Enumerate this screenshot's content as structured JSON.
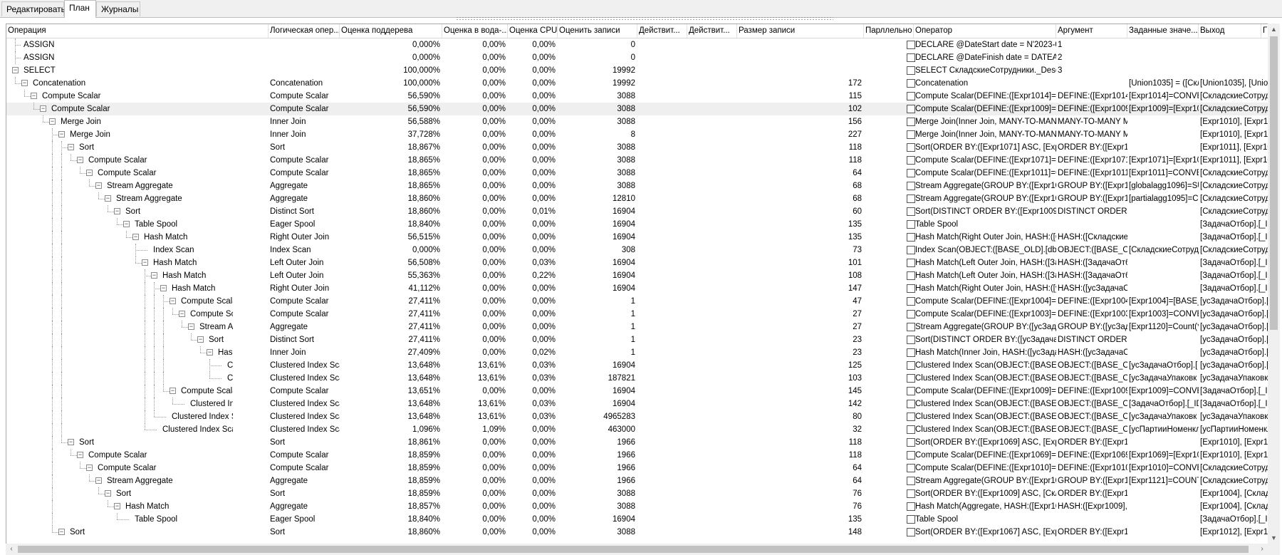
{
  "tabs": [
    {
      "label": "Редактировать",
      "active": false
    },
    {
      "label": "План",
      "active": true
    },
    {
      "label": "Журналы",
      "active": false
    }
  ],
  "columns": [
    "Операция",
    "Логическая опер...",
    "Оценка поддерева",
    "Оценка в вода-...",
    "Оценка CPU",
    "Оценить записи",
    "Действит...",
    "Действит...",
    "Размер записи",
    "Парллельно",
    "Оператор",
    "Аргумент",
    "Заданные значе...",
    "Выход",
    "Г"
  ],
  "rows": [
    {
      "op": "ASSIGN",
      "d": 0,
      "leaf": true,
      "last": false,
      "logical": "",
      "subtree": "0,000%",
      "io": "0,00%",
      "cpu": "0,00%",
      "est": "0",
      "size": "",
      "operator": "DECLARE @DateStart date = N'2023-02-",
      "argument": "1",
      "defined": "",
      "output": ""
    },
    {
      "op": "ASSIGN",
      "d": 0,
      "leaf": true,
      "last": false,
      "logical": "",
      "subtree": "0,000%",
      "io": "0,00%",
      "cpu": "0,00%",
      "est": "0",
      "size": "",
      "operator": "DECLARE @DateFinish date = DATEADD",
      "argument": "2",
      "defined": "",
      "output": ""
    },
    {
      "op": "SELECT",
      "d": 0,
      "leaf": false,
      "last": true,
      "logical": "",
      "subtree": "100,000%",
      "io": "0,00%",
      "cpu": "0,00%",
      "est": "19992",
      "size": "",
      "operator": "SELECT СкладскиеСотрудники._Descri",
      "argument": "3",
      "defined": "",
      "output": ""
    },
    {
      "op": "Concatenation",
      "d": 1,
      "leaf": false,
      "last": true,
      "logical": "Concatenation",
      "subtree": "100,000%",
      "io": "0,00%",
      "cpu": "0,00%",
      "est": "19992",
      "size": "172",
      "operator": "Concatenation",
      "argument": "",
      "defined": "[Union1035] = ([Скла",
      "output": "[Union1035], [Union1"
    },
    {
      "op": "Compute Scalar",
      "d": 2,
      "leaf": false,
      "last": false,
      "logical": "Compute Scalar",
      "subtree": "56,590%",
      "io": "0,00%",
      "cpu": "0,00%",
      "est": "3088",
      "size": "115",
      "operator": "Compute Scalar(DEFINE:([Expr1014]=CO",
      "argument": "DEFINE:([Expr1014]=",
      "defined": "[Expr1014]=CONVER",
      "output": "[СкладскиеСотруд"
    },
    {
      "op": "Compute Scalar",
      "d": 3,
      "leaf": false,
      "last": true,
      "logical": "Compute Scalar",
      "subtree": "56,590%",
      "io": "0,00%",
      "cpu": "0,00%",
      "est": "3088",
      "size": "102",
      "operator": "Compute Scalar(DEFINE:([Expr1009]=[Ex",
      "argument": "DEFINE:([Expr1009]=",
      "defined": "[Expr1009]=[Expr10",
      "output": "[СкладскиеСотруд",
      "sel": true
    },
    {
      "op": "Merge Join",
      "d": 4,
      "leaf": false,
      "last": true,
      "logical": "Inner Join",
      "subtree": "56,588%",
      "io": "0,00%",
      "cpu": "0,00%",
      "est": "3088",
      "size": "156",
      "operator": "Merge Join(Inner Join, MANY-TO-MANY M",
      "argument": "MANY-TO-MANY MI",
      "defined": "",
      "output": "[Expr1010], [Expr10"
    },
    {
      "op": "Merge Join",
      "d": 5,
      "leaf": false,
      "last": false,
      "logical": "Inner Join",
      "subtree": "37,728%",
      "io": "0,00%",
      "cpu": "0,00%",
      "est": "8",
      "size": "227",
      "operator": "Merge Join(Inner Join, MANY-TO-MANY M",
      "argument": "MANY-TO-MANY MI",
      "defined": "",
      "output": "[Expr1010], [Expr10"
    },
    {
      "op": "Sort",
      "d": 6,
      "leaf": false,
      "last": false,
      "logical": "Sort",
      "subtree": "18,867%",
      "io": "0,00%",
      "cpu": "0,00%",
      "est": "3088",
      "size": "118",
      "operator": "Sort(ORDER BY:([Expr1071] ASC, [Expr1",
      "argument": "ORDER BY:([Expr10",
      "defined": "",
      "output": "[Expr1011], [Expr10"
    },
    {
      "op": "Compute Scalar",
      "d": 7,
      "leaf": false,
      "last": true,
      "logical": "Compute Scalar",
      "subtree": "18,865%",
      "io": "0,00%",
      "cpu": "0,00%",
      "est": "3088",
      "size": "118",
      "operator": "Compute Scalar(DEFINE:([Expr1071]=[Ex",
      "argument": "DEFINE:([Expr1071]=",
      "defined": "[Expr1071]=[Expr10",
      "output": "[Expr1011], [Expr10"
    },
    {
      "op": "Compute Scalar",
      "d": 8,
      "leaf": false,
      "last": true,
      "logical": "Compute Scalar",
      "subtree": "18,865%",
      "io": "0,00%",
      "cpu": "0,00%",
      "est": "3088",
      "size": "64",
      "operator": "Compute Scalar(DEFINE:([Expr1011]=CO",
      "argument": "DEFINE:([Expr1011]=",
      "defined": "[Expr1011]=CONVER",
      "output": "[СкладскиеСотруд"
    },
    {
      "op": "Stream Aggregate",
      "d": 9,
      "leaf": false,
      "last": true,
      "logical": "Aggregate",
      "subtree": "18,865%",
      "io": "0,00%",
      "cpu": "0,00%",
      "est": "3088",
      "size": "68",
      "operator": "Stream Aggregate(GROUP BY:([Expr100",
      "argument": "GROUP BY:([Expr10",
      "defined": "[globalagg1096]=SU",
      "output": "[СкладскиеСотруд"
    },
    {
      "op": "Stream Aggregate",
      "d": 10,
      "leaf": false,
      "last": true,
      "logical": "Aggregate",
      "subtree": "18,860%",
      "io": "0,00%",
      "cpu": "0,00%",
      "est": "12810",
      "size": "68",
      "operator": "Stream Aggregate(GROUP BY:([Expr100",
      "argument": "GROUP BY:([Expr10",
      "defined": "[partialagg1095]=Co",
      "output": "[СкладскиеСотруд"
    },
    {
      "op": "Sort",
      "d": 11,
      "leaf": false,
      "last": true,
      "logical": "Distinct Sort",
      "subtree": "18,860%",
      "io": "0,00%",
      "cpu": "0,01%",
      "est": "16904",
      "size": "60",
      "operator": "Sort(DISTINCT ORDER BY:([Expr1009] AS",
      "argument": "DISTINCT ORDER BY",
      "defined": "",
      "output": "[СкладскиеСотруд"
    },
    {
      "op": "Table Spool",
      "d": 12,
      "leaf": false,
      "last": true,
      "logical": "Eager Spool",
      "subtree": "18,840%",
      "io": "0,00%",
      "cpu": "0,00%",
      "est": "16904",
      "size": "135",
      "operator": "Table Spool",
      "argument": "",
      "defined": "",
      "output": "[ЗадачаОтбор].[_ID"
    },
    {
      "op": "Hash Match",
      "d": 13,
      "leaf": false,
      "last": true,
      "logical": "Right Outer Join",
      "subtree": "56,515%",
      "io": "0,00%",
      "cpu": "0,00%",
      "est": "16904",
      "size": "135",
      "operator": "Hash Match(Right Outer Join, HASH:([Ск",
      "argument": "HASH:([Складские",
      "defined": "",
      "output": "[ЗадачаОтбор].[_ID"
    },
    {
      "op": "Index Scan",
      "d": 14,
      "leaf": true,
      "last": false,
      "logical": "Index Scan",
      "subtree": "0,000%",
      "io": "0,00%",
      "cpu": "0,00%",
      "est": "308",
      "size": "73",
      "operator": "Index Scan(OBJECT:([BASE_OLD].[dbo].[",
      "argument": "OBJECT:([BASE_OL",
      "defined": "[СкладскиеСотруд",
      "output": "[СкладскиеСотруд"
    },
    {
      "op": "Hash Match",
      "d": 14,
      "leaf": false,
      "last": true,
      "logical": "Left Outer Join",
      "subtree": "56,508%",
      "io": "0,00%",
      "cpu": "0,03%",
      "est": "16904",
      "size": "101",
      "operator": "Hash Match(Left Outer Join, HASH:([Зад",
      "argument": "HASH:([ЗадачаОтб",
      "defined": "",
      "output": "[ЗадачаОтбор].[_ID"
    },
    {
      "op": "Hash Match",
      "d": 15,
      "leaf": false,
      "last": false,
      "logical": "Left Outer Join",
      "subtree": "55,363%",
      "io": "0,00%",
      "cpu": "0,22%",
      "est": "16904",
      "size": "108",
      "operator": "Hash Match(Left Outer Join, HASH:([Зад",
      "argument": "HASH:([ЗадачаОтб",
      "defined": "",
      "output": "[ЗадачаОтбор].[_ID"
    },
    {
      "op": "Hash Match",
      "d": 16,
      "leaf": false,
      "last": false,
      "logical": "Right Outer Join",
      "subtree": "41,112%",
      "io": "0,00%",
      "cpu": "0,00%",
      "est": "16904",
      "size": "147",
      "operator": "Hash Match(Right Outer Join, HASH:([усЗ",
      "argument": "HASH:([усЗадачаО",
      "defined": "",
      "output": "[ЗадачаОтбор].[_ID"
    },
    {
      "op": "Compute Scalar",
      "d": 17,
      "leaf": false,
      "last": false,
      "logical": "Compute Scalar",
      "subtree": "27,411%",
      "io": "0,00%",
      "cpu": "0,00%",
      "est": "1",
      "size": "47",
      "operator": "Compute Scalar(DEFINE:([Expr1004]=[BA",
      "argument": "DEFINE:([Expr1004]=",
      "defined": "[Expr1004]=[BASE_",
      "output": "[усЗадачаОтбор].["
    },
    {
      "op": "Compute Scalar",
      "d": 18,
      "leaf": false,
      "last": true,
      "logical": "Compute Scalar",
      "subtree": "27,411%",
      "io": "0,00%",
      "cpu": "0,00%",
      "est": "1",
      "size": "27",
      "operator": "Compute Scalar(DEFINE:([Expr1003]=CO",
      "argument": "DEFINE:([Expr1003]=",
      "defined": "[Expr1003]=CONVER",
      "output": "[усЗадачаОтбор].["
    },
    {
      "op": "Stream Aggregate",
      "d": 19,
      "leaf": false,
      "last": true,
      "logical": "Aggregate",
      "subtree": "27,411%",
      "io": "0,00%",
      "cpu": "0,00%",
      "est": "1",
      "size": "27",
      "operator": "Stream Aggregate(GROUP BY:([усЗадача",
      "argument": "GROUP BY:([усЗада",
      "defined": "[Expr1120]=Count(*)",
      "output": "[усЗадачаОтбор].["
    },
    {
      "op": "Sort",
      "d": 20,
      "leaf": false,
      "last": true,
      "logical": "Distinct Sort",
      "subtree": "27,411%",
      "io": "0,00%",
      "cpu": "0,00%",
      "est": "1",
      "size": "23",
      "operator": "Sort(DISTINCT ORDER BY:([усЗадачаОт",
      "argument": "DISTINCT ORDER BY",
      "defined": "",
      "output": "[усЗадачаОтбор].["
    },
    {
      "op": "Hash Match",
      "d": 21,
      "leaf": false,
      "last": true,
      "logical": "Inner Join",
      "subtree": "27,409%",
      "io": "0,00%",
      "cpu": "0,02%",
      "est": "1",
      "size": "23",
      "operator": "Hash Match(Inner Join, HASH:([усЗадача",
      "argument": "HASH:([усЗадачаО",
      "defined": "",
      "output": "[усЗадачаОтбор].["
    },
    {
      "op": "Clustered Index Scan",
      "d": 22,
      "leaf": true,
      "last": false,
      "logical": "Clustered Index Sca",
      "subtree": "13,648%",
      "io": "13,61%",
      "cpu": "0,03%",
      "est": "16904",
      "size": "125",
      "operator": "Clustered Index Scan(OBJECT:([BASE_C",
      "argument": "OBJECT:([BASE_OL",
      "defined": "[усЗадачаОтбор].[",
      "output": "[усЗадачаОтбор].["
    },
    {
      "op": "Clustered Index Scan",
      "d": 22,
      "leaf": true,
      "last": true,
      "logical": "Clustered Index Sca",
      "subtree": "13,648%",
      "io": "13,61%",
      "cpu": "0,03%",
      "est": "187821",
      "size": "103",
      "operator": "Clustered Index Scan(OBJECT:([BASE_C",
      "argument": "OBJECT:([BASE_OL",
      "defined": "[усЗадачаУпаковк",
      "output": "[усЗадачаУпаковк"
    },
    {
      "op": "Compute Scalar",
      "d": 17,
      "leaf": false,
      "last": true,
      "logical": "Compute Scalar",
      "subtree": "13,651%",
      "io": "0,00%",
      "cpu": "0,00%",
      "est": "16904",
      "size": "145",
      "operator": "Compute Scalar(DEFINE:([Expr1009]=CO",
      "argument": "DEFINE:([Expr1009]=",
      "defined": "[Expr1009]=CONVER",
      "output": "[ЗадачаОтбор].[_ID"
    },
    {
      "op": "Clustered Index Scan",
      "d": 18,
      "leaf": true,
      "last": true,
      "logical": "Clustered Index Sca",
      "subtree": "13,648%",
      "io": "13,61%",
      "cpu": "0,03%",
      "est": "16904",
      "size": "142",
      "operator": "Clustered Index Scan(OBJECT:([BASE_C",
      "argument": "OBJECT:([BASE_OL",
      "defined": "[ЗадачаОтбор].[_ID",
      "output": "[ЗадачаОтбор].[_ID"
    },
    {
      "op": "Clustered Index Scan",
      "d": 16,
      "leaf": true,
      "last": true,
      "logical": "Clustered Index Sca",
      "subtree": "13,648%",
      "io": "13,61%",
      "cpu": "0,03%",
      "est": "4965283",
      "size": "80",
      "operator": "Clustered Index Scan(OBJECT:([BASE_C",
      "argument": "OBJECT:([BASE_OL",
      "defined": "[усЗадачаУпаковк",
      "output": "[усЗадачаУпаковк"
    },
    {
      "op": "Clustered Index Scan",
      "d": 15,
      "leaf": true,
      "last": true,
      "logical": "Clustered Index Sca",
      "subtree": "1,096%",
      "io": "1,09%",
      "cpu": "0,00%",
      "est": "463000",
      "size": "32",
      "operator": "Clustered Index Scan(OBJECT:([BASE_C",
      "argument": "OBJECT:([BASE_OL",
      "defined": "[усПартииНоменкл",
      "output": "[усПартииНоменкл"
    },
    {
      "op": "Sort",
      "d": 6,
      "leaf": false,
      "last": true,
      "logical": "Sort",
      "subtree": "18,861%",
      "io": "0,00%",
      "cpu": "0,00%",
      "est": "1966",
      "size": "118",
      "operator": "Sort(ORDER BY:([Expr1069] ASC, [Expr1",
      "argument": "ORDER BY:([Expr10",
      "defined": "",
      "output": "[Expr1010], [Expr10"
    },
    {
      "op": "Compute Scalar",
      "d": 7,
      "leaf": false,
      "last": true,
      "logical": "Compute Scalar",
      "subtree": "18,859%",
      "io": "0,00%",
      "cpu": "0,00%",
      "est": "1966",
      "size": "118",
      "operator": "Compute Scalar(DEFINE:([Expr1069]=[Ex",
      "argument": "DEFINE:([Expr1069]=",
      "defined": "[Expr1069]=[Expr10",
      "output": "[Expr1010], [Expr10"
    },
    {
      "op": "Compute Scalar",
      "d": 8,
      "leaf": false,
      "last": true,
      "logical": "Compute Scalar",
      "subtree": "18,859%",
      "io": "0,00%",
      "cpu": "0,00%",
      "est": "1966",
      "size": "64",
      "operator": "Compute Scalar(DEFINE:([Expr1010]=CO",
      "argument": "DEFINE:([Expr1010]=",
      "defined": "[Expr1010]=CONVER",
      "output": "[СкладскиеСотруд"
    },
    {
      "op": "Stream Aggregate",
      "d": 9,
      "leaf": false,
      "last": true,
      "logical": "Aggregate",
      "subtree": "18,859%",
      "io": "0,00%",
      "cpu": "0,00%",
      "est": "1966",
      "size": "64",
      "operator": "Stream Aggregate(GROUP BY:([Expr100",
      "argument": "GROUP BY:([Expr10",
      "defined": "[Expr1121]=COUNT(",
      "output": "[СкладскиеСотруд"
    },
    {
      "op": "Sort",
      "d": 10,
      "leaf": false,
      "last": true,
      "logical": "Sort",
      "subtree": "18,859%",
      "io": "0,00%",
      "cpu": "0,00%",
      "est": "3088",
      "size": "76",
      "operator": "Sort(ORDER BY:([Expr1009] ASC, [Скла",
      "argument": "ORDER BY:([Expr10",
      "defined": "",
      "output": "[Expr1004], [Склад"
    },
    {
      "op": "Hash Match",
      "d": 11,
      "leaf": false,
      "last": true,
      "logical": "Aggregate",
      "subtree": "18,857%",
      "io": "0,00%",
      "cpu": "0,00%",
      "est": "3088",
      "size": "76",
      "operator": "Hash Match(Aggregate, HASH:([Expr100",
      "argument": "HASH:([Expr1009], [",
      "defined": "",
      "output": "[Expr1004], [Склад"
    },
    {
      "op": "Table Spool",
      "d": 12,
      "leaf": true,
      "last": true,
      "logical": "Eager Spool",
      "subtree": "18,840%",
      "io": "0,00%",
      "cpu": "0,00%",
      "est": "16904",
      "size": "135",
      "operator": "Table Spool",
      "argument": "",
      "defined": "",
      "output": "[ЗадачаОтбор].[_ID"
    },
    {
      "op": "Sort",
      "d": 5,
      "leaf": false,
      "last": false,
      "logical": "Sort",
      "subtree": "18,860%",
      "io": "0,00%",
      "cpu": "0,00%",
      "est": "3088",
      "size": "148",
      "operator": "Sort(ORDER BY:([Expr1067] ASC, [Expr1",
      "argument": "ORDER BY:([Expr10",
      "defined": "",
      "output": "[Expr1012], [Expr10"
    }
  ],
  "colors": {
    "row_selected": "#efefef",
    "tree_lines": "#999999"
  }
}
